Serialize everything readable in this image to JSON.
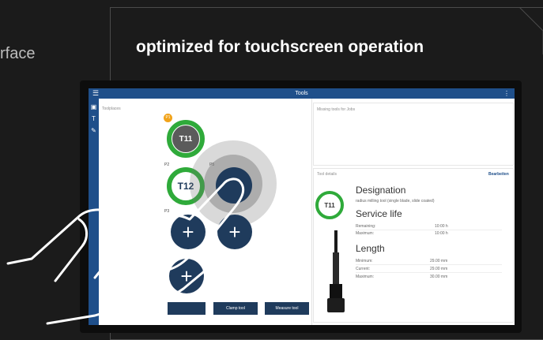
{
  "hero": {
    "left_fragment": "rface",
    "headline": "optimized for touchscreen operation"
  },
  "app": {
    "title": "Tools",
    "menu_icon": "☰",
    "kebab_icon": "⋮",
    "sidebar_icons": [
      "clipboard-icon",
      "tool-icon",
      "wrench-icon"
    ],
    "toolplaces_label": "Toolplaces",
    "missing_tools_label": "Missing tools for Jobs",
    "tool_details_label": "Tool details",
    "edit_label": "Bearbeiten",
    "slots": {
      "p1_badge": "P1",
      "p2_label": "P2",
      "p3_label": "P3",
      "p5_label": "P5",
      "t11": "T11",
      "t12": "T12",
      "plus": "+"
    },
    "buttons": {
      "clamp_tool": "Clamp tool",
      "measure_tool": "Measure tool"
    },
    "details": {
      "tool_id": "T11",
      "designation_heading": "Designation",
      "designation_value": "radius milling tool (single blade, slide coated)",
      "service_life_heading": "Service life",
      "remaining_label": "Remaining:",
      "remaining_value": "10:00 h",
      "maximum_label": "Maximum:",
      "maximum_value": "10:00 h",
      "length_heading": "Length",
      "minimum_label": "Minimum:",
      "minimum_value": "29.00 mm",
      "current_label": "Current:",
      "current_value": "29.00 mm",
      "length_maximum_label": "Maximum:",
      "length_maximum_value": "30.00 mm"
    },
    "colors": {
      "titlebar": "#1f4f8a",
      "slot_navy": "#1f3b5c",
      "slot_green": "#2faa3a",
      "badge": "#f1a31a"
    }
  }
}
